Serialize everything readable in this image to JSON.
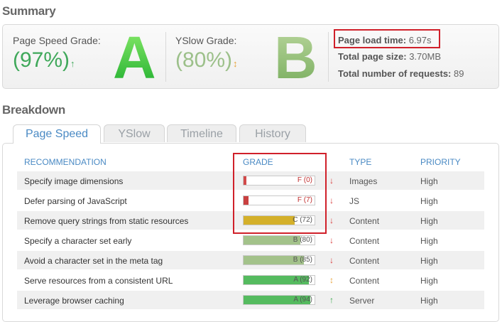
{
  "summary": {
    "title": "Summary",
    "pagespeed": {
      "label": "Page Speed Grade:",
      "percent": "(97%)",
      "arrow": "↑",
      "letter": "A"
    },
    "yslow": {
      "label": "YSlow Grade:",
      "percent": "(80%)",
      "arrow": "↕",
      "letter": "B"
    },
    "stats": {
      "load_label": "Page load time:",
      "load_value": "6.97s",
      "size_label": "Total page size:",
      "size_value": "3.70MB",
      "req_label": "Total number of requests:",
      "req_value": "89"
    }
  },
  "breakdown": {
    "title": "Breakdown",
    "tabs": [
      "Page Speed",
      "YSlow",
      "Timeline",
      "History"
    ],
    "columns": [
      "RECOMMENDATION",
      "GRADE",
      "TYPE",
      "PRIORITY"
    ],
    "rows": [
      {
        "recommendation": "Specify image dimensions",
        "grade": "F (0)",
        "score": 0,
        "fill": "#d24a4a",
        "dir": "↓",
        "dir_color": "#d83a3a",
        "type": "Images",
        "priority": "High"
      },
      {
        "recommendation": "Defer parsing of JavaScript",
        "grade": "F (7)",
        "score": 7,
        "fill": "#c94040",
        "dir": "↓",
        "dir_color": "#d83a3a",
        "type": "JS",
        "priority": "High"
      },
      {
        "recommendation": "Remove query strings from static resources",
        "grade": "C (72)",
        "score": 72,
        "fill": "#d4b02a",
        "dir": "↓",
        "dir_color": "#d83a3a",
        "type": "Content",
        "priority": "High"
      },
      {
        "recommendation": "Specify a character set early",
        "grade": "B (80)",
        "score": 80,
        "fill": "#a3c28a",
        "dir": "↓",
        "dir_color": "#d83a3a",
        "type": "Content",
        "priority": "High"
      },
      {
        "recommendation": "Avoid a character set in the meta tag",
        "grade": "B (85)",
        "score": 85,
        "fill": "#a3c28a",
        "dir": "↓",
        "dir_color": "#d83a3a",
        "type": "Content",
        "priority": "High"
      },
      {
        "recommendation": "Serve resources from a consistent URL",
        "grade": "A (92)",
        "score": 92,
        "fill": "#55bb5f",
        "dir": "↕",
        "dir_color": "#e8a33a",
        "type": "Content",
        "priority": "High"
      },
      {
        "recommendation": "Leverage browser caching",
        "grade": "A (94)",
        "score": 94,
        "fill": "#55bb5f",
        "dir": "↑",
        "dir_color": "#3aa84a",
        "type": "Server",
        "priority": "High"
      }
    ]
  }
}
